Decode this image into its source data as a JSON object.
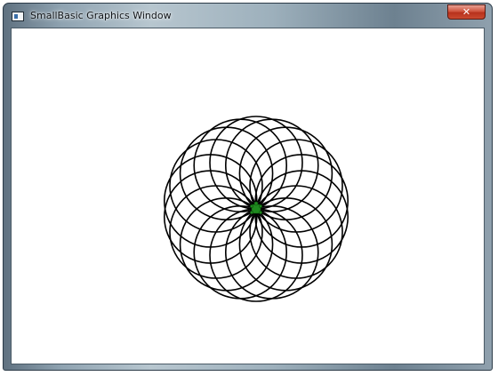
{
  "window": {
    "title": "SmallBasic Graphics Window",
    "close_label": "✕"
  },
  "drawing": {
    "circle_count": 18,
    "circle_radius": 52,
    "stroke_color": "#000000",
    "background": "#ffffff",
    "turtle_color": "#1f8a1f"
  }
}
